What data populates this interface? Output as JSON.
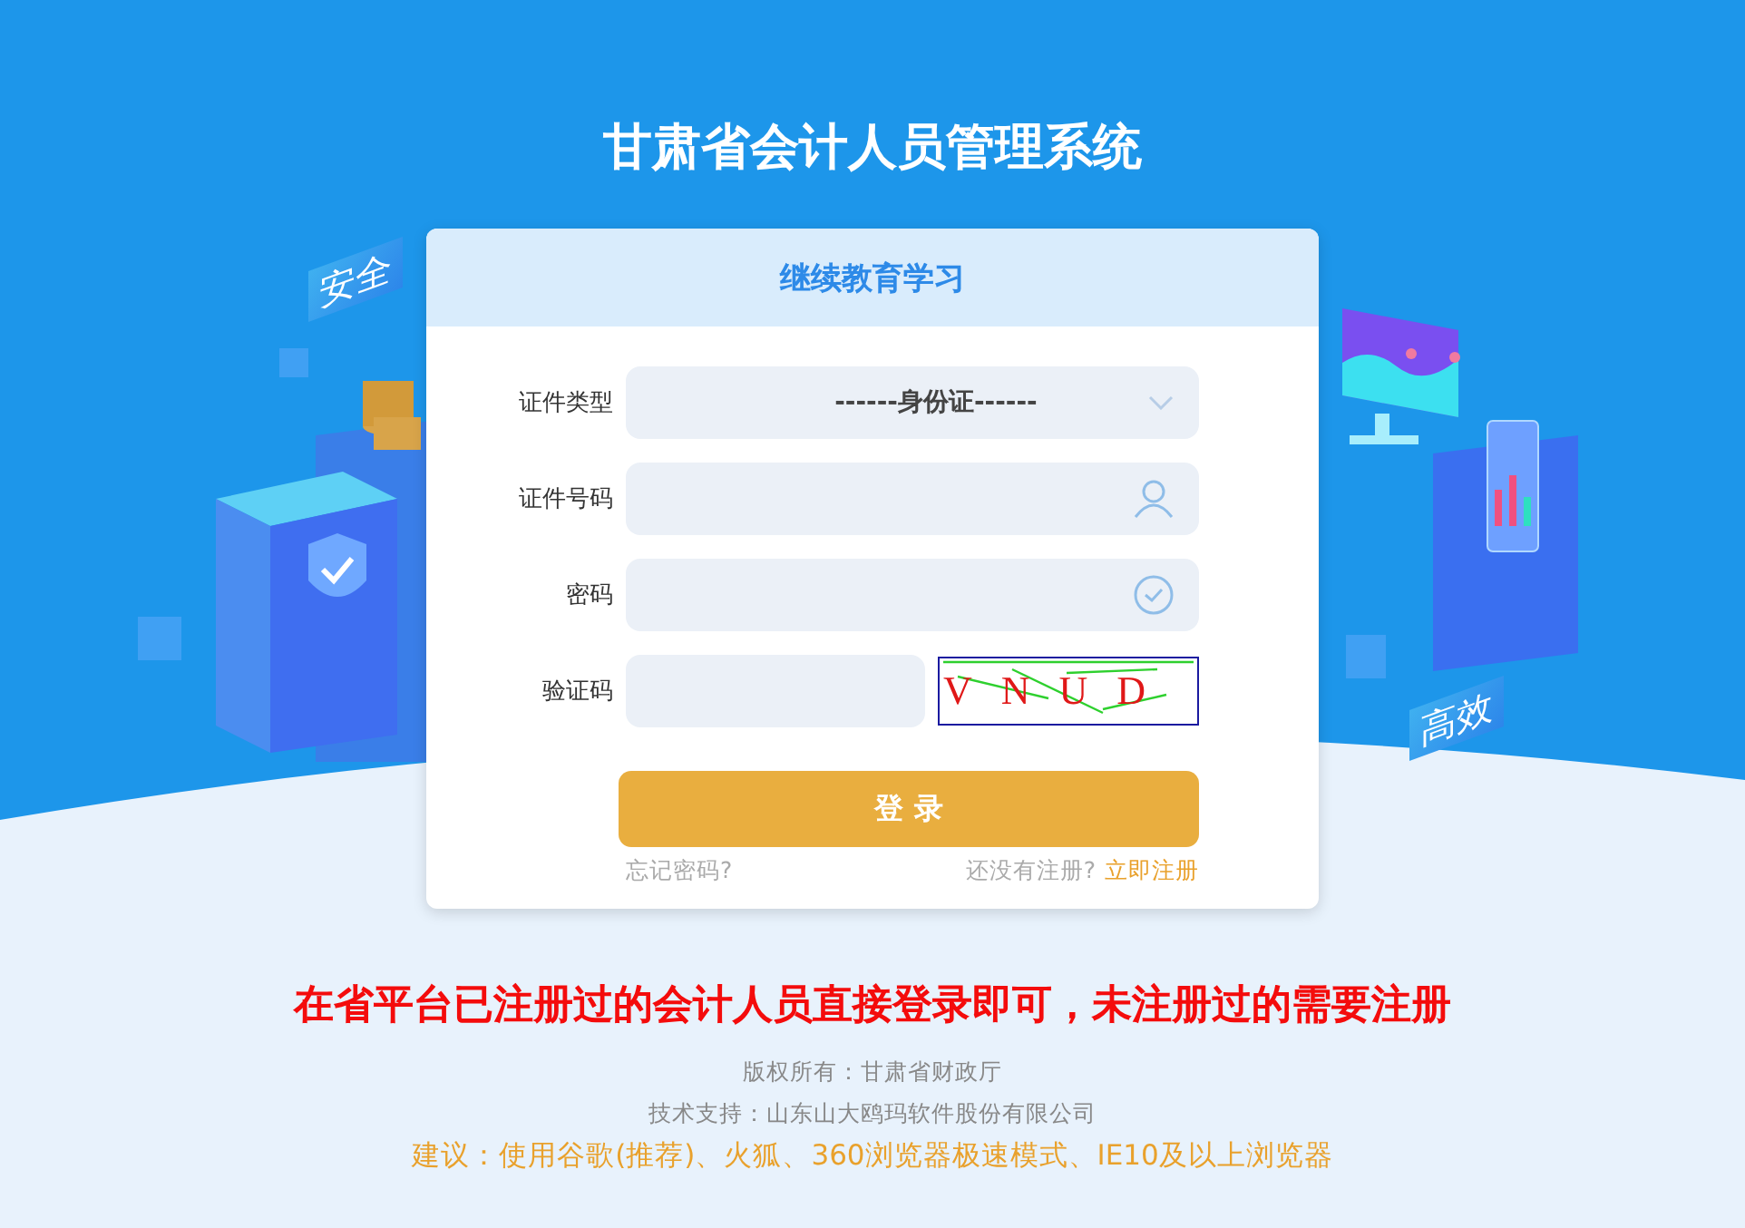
{
  "page": {
    "title": "甘肃省会计人员管理系统"
  },
  "illustration": {
    "left_tag": "安全",
    "right_tag": "高效"
  },
  "login_card": {
    "title": "继续教育学习",
    "fields": [
      {
        "kind": "select",
        "label": "证件类型",
        "value": "------身份证------"
      },
      {
        "kind": "user",
        "label": "证件号码"
      },
      {
        "kind": "password",
        "label": "密码"
      },
      {
        "kind": "captcha",
        "label": "验证码",
        "captcha_text": "VNUD"
      }
    ],
    "login_button": "登 录",
    "forgot_link": "忘记密码?",
    "register_prompt": "还没有注册?",
    "register_link": "立即注册"
  },
  "notice": "在省平台已注册过的会计人员直接登录即可，未注册过的需要注册",
  "footer": {
    "copyright": "版权所有：甘肃省财政厅",
    "support": "技术支持：山东山大鸥玛软件股份有限公司",
    "suggestion": "建议：使用谷歌(推荐)、火狐、360浏览器极速模式、IE10及以上浏览器"
  }
}
